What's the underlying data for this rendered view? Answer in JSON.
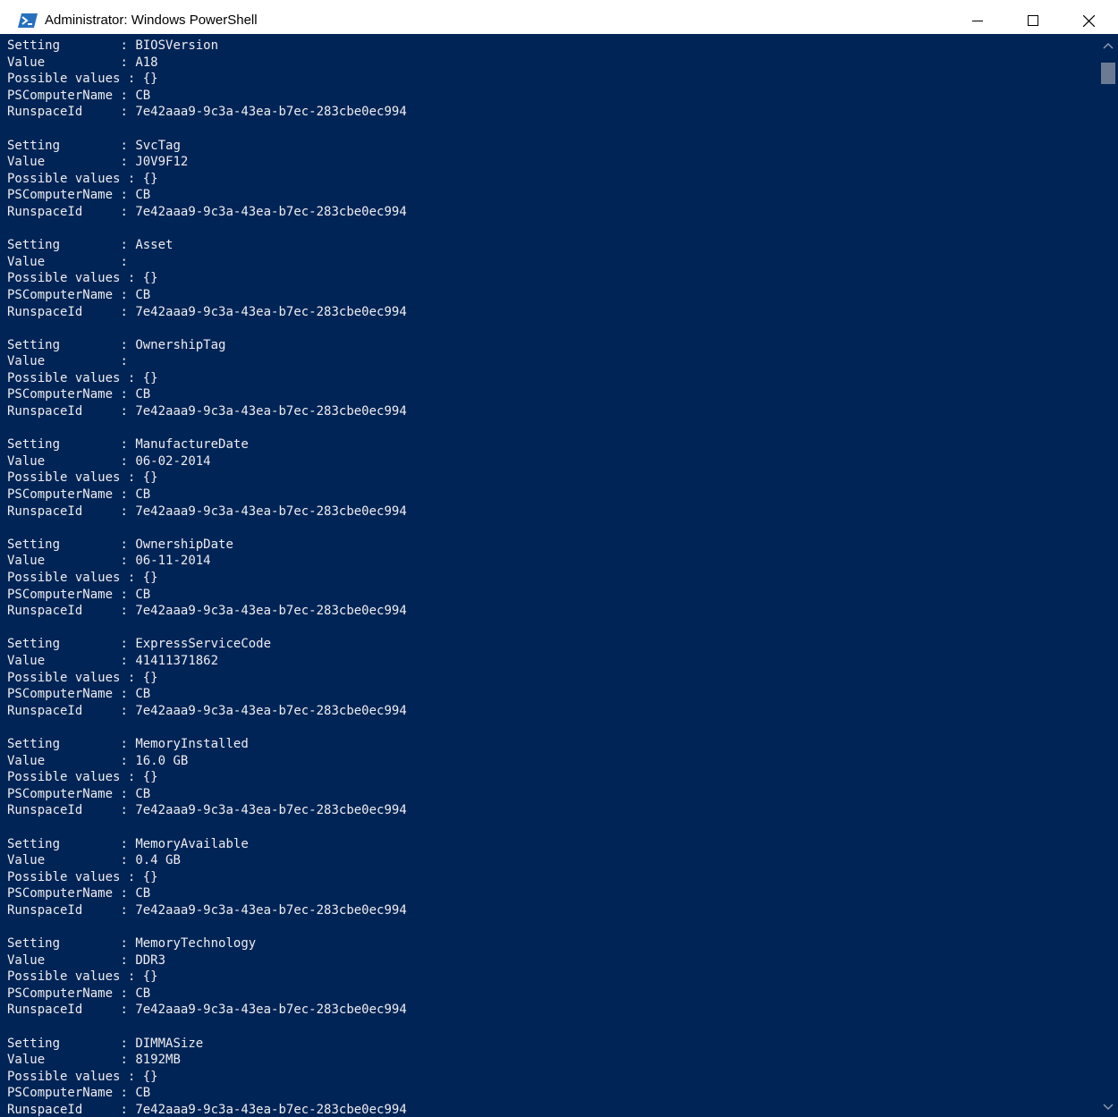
{
  "window": {
    "title": "Administrator: Windows PowerShell",
    "icon": "powershell-icon",
    "controls": [
      "minimize-icon",
      "maximize-icon",
      "close-icon"
    ],
    "background": "#012456",
    "text_color": "#eeedf0"
  },
  "labels": {
    "setting": "Setting       ",
    "value": "Value         ",
    "possible": "Possible values",
    "computer": "PSComputerName",
    "runspace": "RunspaceId    "
  },
  "separator": " : ",
  "records": [
    {
      "setting": "BIOSVersion",
      "value": "A18",
      "possible": "{}",
      "computer": "CB",
      "runspace": "7e42aaa9-9c3a-43ea-b7ec-283cbe0ec994"
    },
    {
      "setting": "SvcTag",
      "value": "J0V9F12",
      "possible": "{}",
      "computer": "CB",
      "runspace": "7e42aaa9-9c3a-43ea-b7ec-283cbe0ec994"
    },
    {
      "setting": "Asset",
      "value": "",
      "possible": "{}",
      "computer": "CB",
      "runspace": "7e42aaa9-9c3a-43ea-b7ec-283cbe0ec994"
    },
    {
      "setting": "OwnershipTag",
      "value": "",
      "possible": "{}",
      "computer": "CB",
      "runspace": "7e42aaa9-9c3a-43ea-b7ec-283cbe0ec994"
    },
    {
      "setting": "ManufactureDate",
      "value": "06-02-2014",
      "possible": "{}",
      "computer": "CB",
      "runspace": "7e42aaa9-9c3a-43ea-b7ec-283cbe0ec994"
    },
    {
      "setting": "OwnershipDate",
      "value": "06-11-2014",
      "possible": "{}",
      "computer": "CB",
      "runspace": "7e42aaa9-9c3a-43ea-b7ec-283cbe0ec994"
    },
    {
      "setting": "ExpressServiceCode",
      "value": "41411371862",
      "possible": "{}",
      "computer": "CB",
      "runspace": "7e42aaa9-9c3a-43ea-b7ec-283cbe0ec994"
    },
    {
      "setting": "MemoryInstalled",
      "value": "16.0 GB",
      "possible": "{}",
      "computer": "CB",
      "runspace": "7e42aaa9-9c3a-43ea-b7ec-283cbe0ec994"
    },
    {
      "setting": "MemoryAvailable",
      "value": "0.4 GB",
      "possible": "{}",
      "computer": "CB",
      "runspace": "7e42aaa9-9c3a-43ea-b7ec-283cbe0ec994"
    },
    {
      "setting": "MemoryTechnology",
      "value": "DDR3",
      "possible": "{}",
      "computer": "CB",
      "runspace": "7e42aaa9-9c3a-43ea-b7ec-283cbe0ec994"
    },
    {
      "setting": "DIMMASize",
      "value": "8192MB",
      "possible": "{}",
      "computer": "CB",
      "runspace": "7e42aaa9-9c3a-43ea-b7ec-283cbe0ec994"
    }
  ],
  "scrollbar": {
    "up": "scroll-up-arrow-icon",
    "down": "scroll-down-arrow-icon"
  }
}
